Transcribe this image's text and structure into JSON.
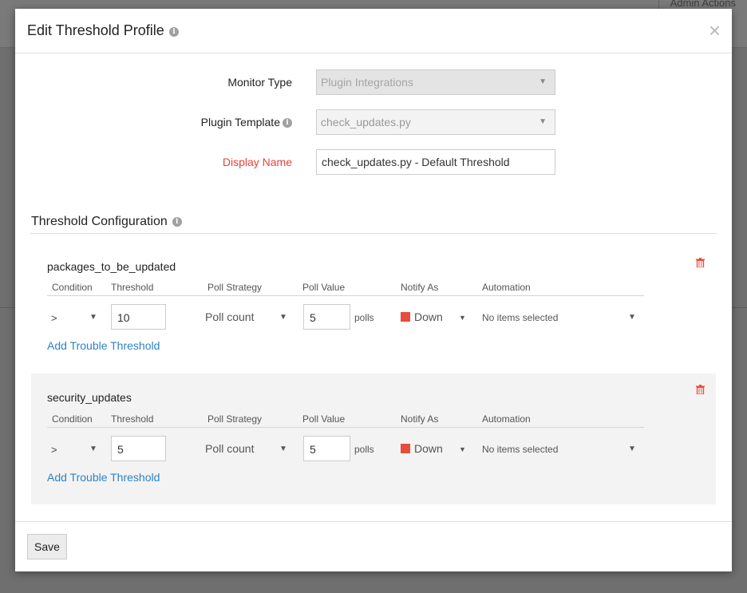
{
  "background": {
    "admin_actions": "Admin Actions"
  },
  "modal": {
    "title": "Edit Threshold Profile",
    "close": "×"
  },
  "form": {
    "monitor_type": {
      "label": "Monitor Type",
      "value": "Plugin Integrations"
    },
    "plugin_template": {
      "label": "Plugin Template",
      "value": "check_updates.py"
    },
    "display_name": {
      "label": "Display Name",
      "value": "check_updates.py - Default Threshold"
    }
  },
  "threshold_config": {
    "title": "Threshold Configuration",
    "columns": [
      "Condition",
      "Threshold",
      "Poll Strategy",
      "Poll Value",
      "Notify As",
      "Automation"
    ],
    "metrics": [
      {
        "name": "packages_to_be_updated",
        "condition": ">",
        "threshold": "10",
        "poll_strategy": "Poll count",
        "poll_value": "5",
        "poll_unit": "polls",
        "notify_as": "Down",
        "automation": "No items selected",
        "add_link": "Add Trouble Threshold"
      },
      {
        "name": "security_updates",
        "condition": ">",
        "threshold": "5",
        "poll_strategy": "Poll count",
        "poll_value": "5",
        "poll_unit": "polls",
        "notify_as": "Down",
        "automation": "No items selected",
        "add_link": "Add Trouble Threshold"
      }
    ]
  },
  "footer": {
    "save_label": "Save"
  },
  "colors": {
    "accent_link": "#2b83c5",
    "status_down": "#e84c3d",
    "required_label": "#e5453a"
  }
}
